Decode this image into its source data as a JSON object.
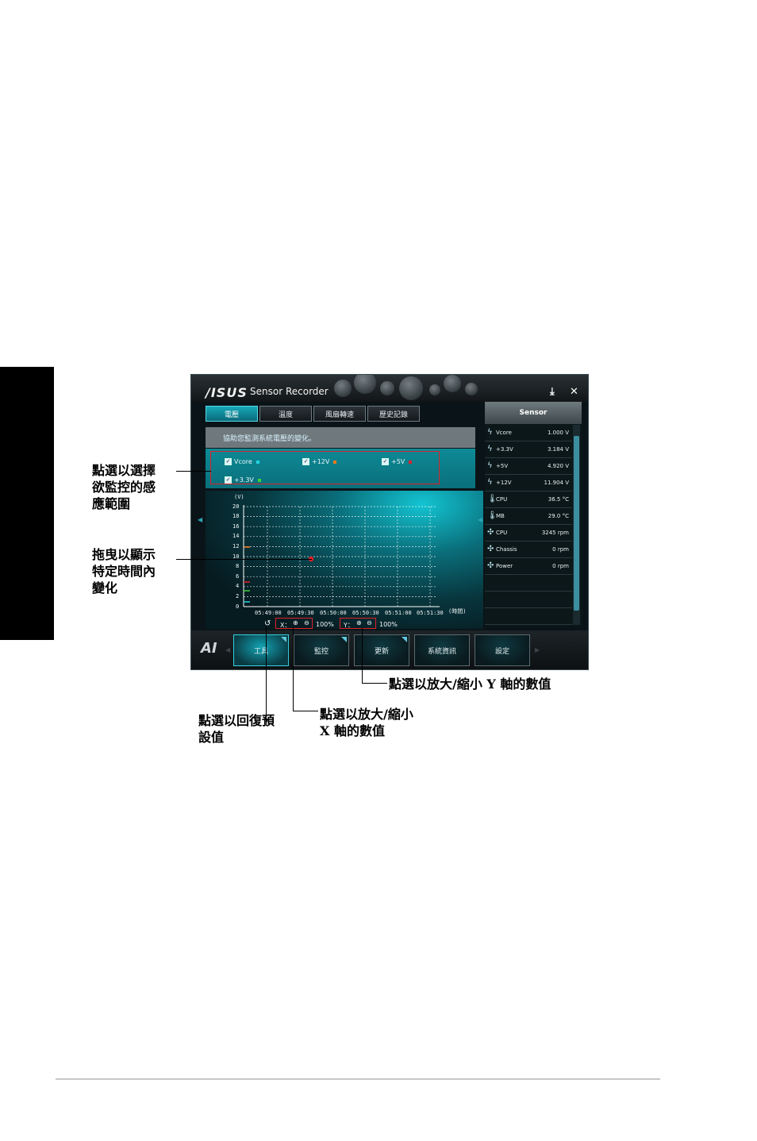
{
  "window": {
    "logo": "/ISUS",
    "title": "Sensor Recorder",
    "tabs": [
      {
        "label": "電壓",
        "active": true
      },
      {
        "label": "溫度",
        "active": false
      },
      {
        "label": "風扇轉速",
        "active": false
      },
      {
        "label": "歷史記錄",
        "active": false
      }
    ],
    "description": "協助您監測系統電壓的變化。",
    "checkboxes": [
      {
        "label": "Vcore",
        "checked": true,
        "color": "#23d4e0"
      },
      {
        "label": "+12V",
        "checked": true,
        "color": "#f07a20"
      },
      {
        "label": "+5V",
        "checked": true,
        "color": "#e0202a"
      },
      {
        "label": "+3.3V",
        "checked": true,
        "color": "#3bd23b"
      }
    ],
    "graph": {
      "unit": "(V)",
      "y_ticks": [
        "20",
        "18",
        "16",
        "14",
        "12",
        "10",
        "8",
        "6",
        "4",
        "2",
        "0"
      ],
      "x_ticks": [
        "05:49:00",
        "05:49:30",
        "05:50:00",
        "05:50:30",
        "05:51:00",
        "05:51:30"
      ],
      "x_unit": "(時間)",
      "x_zoom_label": "X：",
      "x_zoom_value": "100%",
      "y_zoom_label": "Y：",
      "y_zoom_value": "100%"
    },
    "sensor_panel": {
      "header": "Sensor",
      "rows": [
        {
          "icon": "lightning-icon",
          "name": "Vcore",
          "value": "1.000  V"
        },
        {
          "icon": "lightning-icon",
          "name": "+3.3V",
          "value": "3.184  V"
        },
        {
          "icon": "lightning-icon",
          "name": "+5V",
          "value": "4.920  V"
        },
        {
          "icon": "lightning-icon",
          "name": "+12V",
          "value": "11.904  V"
        },
        {
          "icon": "thermometer-icon",
          "name": "CPU",
          "value": "36.5 °C"
        },
        {
          "icon": "thermometer-icon",
          "name": "MB",
          "value": "29.0 °C"
        },
        {
          "icon": "fan-icon",
          "name": "CPU",
          "value": "3245  rpm"
        },
        {
          "icon": "fan-icon",
          "name": "Chassis",
          "value": "0  rpm"
        },
        {
          "icon": "fan-icon",
          "name": "Power",
          "value": "0  rpm"
        }
      ]
    },
    "nav": [
      {
        "label": "工具",
        "active": true
      },
      {
        "label": "監控",
        "active": false
      },
      {
        "label": "更新",
        "active": false
      },
      {
        "label": "系統資訊",
        "active": false
      },
      {
        "label": "設定",
        "active": false
      }
    ],
    "ai_logo": "AI"
  },
  "annotations": {
    "select_range": "點選以選擇\n欲監控的感\n應範圍",
    "drag_time": "拖曳以顯示\n特定時間內\n變化",
    "zoom_y": "點選以放大/縮小 Y 軸的數值",
    "zoom_x": "點選以放大/縮小\n X 軸的數值",
    "reset": "點選以回復預\n設值"
  }
}
